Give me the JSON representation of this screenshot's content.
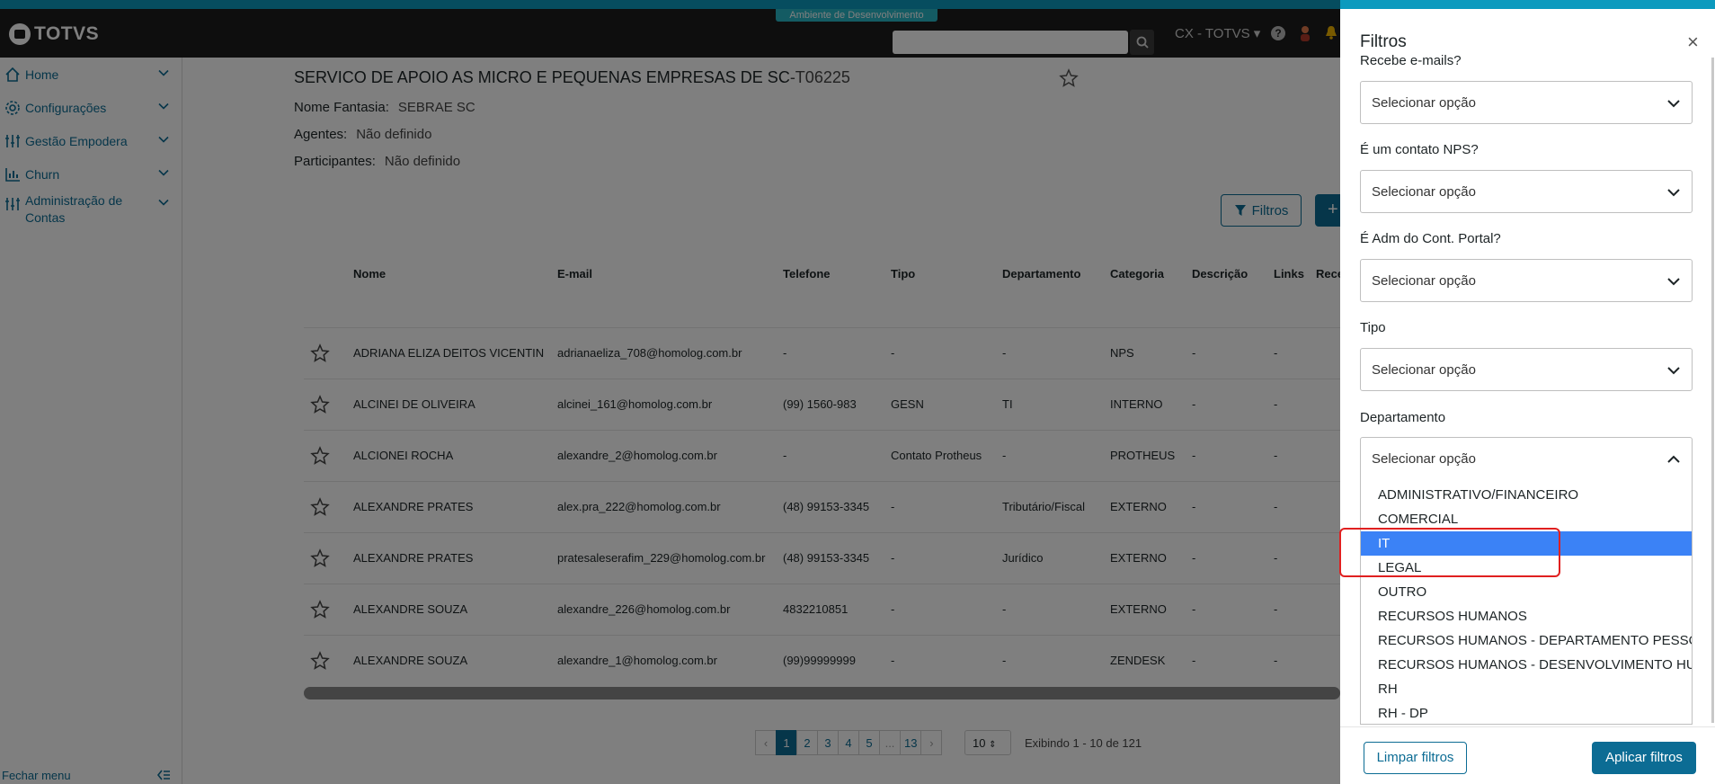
{
  "env_badge": "Ambiente de Desenvolvimento",
  "logo": "TOTVS",
  "header": {
    "search_placeholder": "",
    "user_menu": "CX - TOTVS ▾",
    "help": "?"
  },
  "sidebar": {
    "items": [
      {
        "label": "Home",
        "icon": "home-icon"
      },
      {
        "label": "Configurações",
        "icon": "gear-icon"
      },
      {
        "label": "Gestão Empodera",
        "icon": "sliders-icon"
      },
      {
        "label": "Churn",
        "icon": "bar-chart-icon"
      },
      {
        "label": "Administração de Contas",
        "icon": "sliders-icon"
      }
    ],
    "close_menu": "Fechar menu"
  },
  "account": {
    "title": "SERVICO DE APOIO AS MICRO E PEQUENAS EMPRESAS DE SC",
    "code": "-T06225",
    "nome_fantasia_label": "Nome Fantasia:",
    "nome_fantasia": "SEBRAE SC",
    "agentes_label": "Agentes:",
    "agentes": "Não definido",
    "participantes_label": "Participantes:",
    "participantes": "Não definido"
  },
  "toolbar": {
    "filtros": "Filtros",
    "add": "+"
  },
  "table": {
    "columns": [
      "Nome",
      "E-mail",
      "Telefone",
      "Tipo",
      "Departamento",
      "Categoria",
      "Descrição",
      "Links",
      "Rece"
    ],
    "rows": [
      {
        "nome": "ADRIANA ELIZA DEITOS VICENTIN",
        "email": "adrianaeliza_708@homolog.com.br",
        "telefone": "-",
        "tipo": "-",
        "departamento": "-",
        "categoria": "NPS",
        "descricao": "-",
        "links": "-"
      },
      {
        "nome": "ALCINEI DE OLIVEIRA",
        "email": "alcinei_161@homolog.com.br",
        "telefone": "(99) 1560-983",
        "tipo": "GESN",
        "departamento": "TI",
        "categoria": "INTERNO",
        "descricao": "-",
        "links": "-"
      },
      {
        "nome": "ALCIONEI ROCHA",
        "email": "alexandre_2@homolog.com.br",
        "telefone": "-",
        "tipo": "Contato Protheus",
        "departamento": "-",
        "categoria": "PROTHEUS",
        "descricao": "-",
        "links": "-"
      },
      {
        "nome": "ALEXANDRE PRATES",
        "email": "alex.pra_222@homolog.com.br",
        "telefone": "(48) 99153-3345",
        "tipo": "-",
        "departamento": "Tributário/Fiscal",
        "categoria": "EXTERNO",
        "descricao": "-",
        "links": "-"
      },
      {
        "nome": "ALEXANDRE PRATES",
        "email": "pratesaleserafim_229@homolog.com.br",
        "telefone": "(48) 99153-3345",
        "tipo": "-",
        "departamento": "Jurídico",
        "categoria": "EXTERNO",
        "descricao": "-",
        "links": "-"
      },
      {
        "nome": "ALEXANDRE SOUZA",
        "email": "alexandre_226@homolog.com.br",
        "telefone": "4832210851",
        "tipo": "-",
        "departamento": "-",
        "categoria": "EXTERNO",
        "descricao": "-",
        "links": "-"
      },
      {
        "nome": "ALEXANDRE SOUZA",
        "email": "alexandre_1@homolog.com.br",
        "telefone": "(99)99999999",
        "tipo": "-",
        "departamento": "-",
        "categoria": "ZENDESK",
        "descricao": "-",
        "links": "-"
      }
    ]
  },
  "pagination": {
    "prev": "‹",
    "pages": [
      "1",
      "2",
      "3",
      "4",
      "5",
      "...",
      "13"
    ],
    "next": "›",
    "page_size": "10",
    "showing": "Exibindo 1 - 10 de 121"
  },
  "filter_panel": {
    "title": "Filtros",
    "close": "×",
    "fields": [
      {
        "label": "Recebe e-mails?",
        "value": "Selecionar opção"
      },
      {
        "label": "É um contato NPS?",
        "value": "Selecionar opção"
      },
      {
        "label": "É Adm do Cont. Portal?",
        "value": "Selecionar opção"
      },
      {
        "label": "Tipo",
        "value": "Selecionar opção"
      },
      {
        "label": "Departamento",
        "value": "Selecionar opção"
      }
    ],
    "department_options": [
      "ADMINISTRATIVO/FINANCEIRO",
      "COMERCIAL",
      "IT",
      "LEGAL",
      "OUTRO",
      "RECURSOS HUMANOS",
      "RECURSOS HUMANOS - DEPARTAMENTO PESSOAL",
      "RECURSOS HUMANOS - DESENVOLVIMENTO HUMANO",
      "RH",
      "RH - DP"
    ],
    "highlighted_option": "IT",
    "clear_button": "Limpar filtros",
    "apply_button": "Aplicar filtros"
  },
  "colors": {
    "primary": "#0c6c94",
    "highlight": "#3b82f6",
    "header_bg": "#1c1c1c",
    "annotation_red": "#e02020"
  }
}
